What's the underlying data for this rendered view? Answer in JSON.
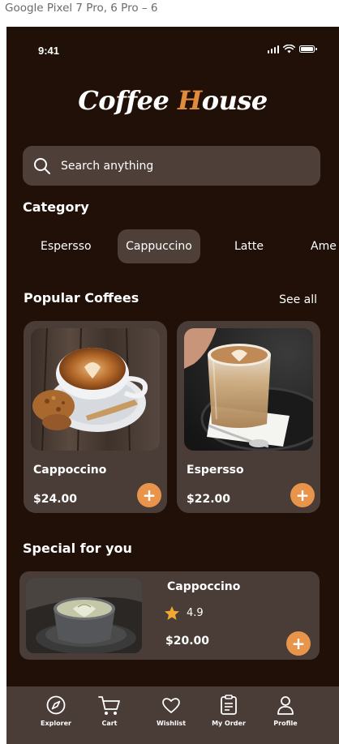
{
  "frame_label": "Google Pixel 7 Pro, 6 Pro – 6",
  "status_bar": {
    "time": "9:41"
  },
  "logo": {
    "part1": "Coffee ",
    "part2": "H",
    "part3": "ouse"
  },
  "search": {
    "placeholder": "Search anything"
  },
  "category": {
    "title": "Category",
    "items": [
      "Espersso",
      "Cappuccino",
      "Latte",
      "Ame"
    ],
    "selected": "Cappuccino"
  },
  "popular": {
    "title": "Popular Coffees",
    "see_all": "See all",
    "items": [
      {
        "name": "Cappoccino",
        "price": "$24.00",
        "add": "+"
      },
      {
        "name": "Espersso",
        "price": "$22.00",
        "add": "+"
      }
    ]
  },
  "special": {
    "title": "Special for you",
    "item": {
      "name": "Cappoccino",
      "rating": "4.9",
      "price": "$20.00",
      "add": "+"
    }
  },
  "bottom_nav": {
    "items": [
      {
        "label": "Explorer",
        "icon": "compass-icon"
      },
      {
        "label": "Cart",
        "icon": "cart-icon"
      },
      {
        "label": "Wishlist",
        "icon": "heart-icon"
      },
      {
        "label": "My Order",
        "icon": "clipboard-icon"
      },
      {
        "label": "Profile",
        "icon": "user-icon"
      }
    ]
  },
  "colors": {
    "background": "#201008",
    "surface": "#4a3c36",
    "accent": "#e8944a",
    "star": "#f0a830"
  }
}
